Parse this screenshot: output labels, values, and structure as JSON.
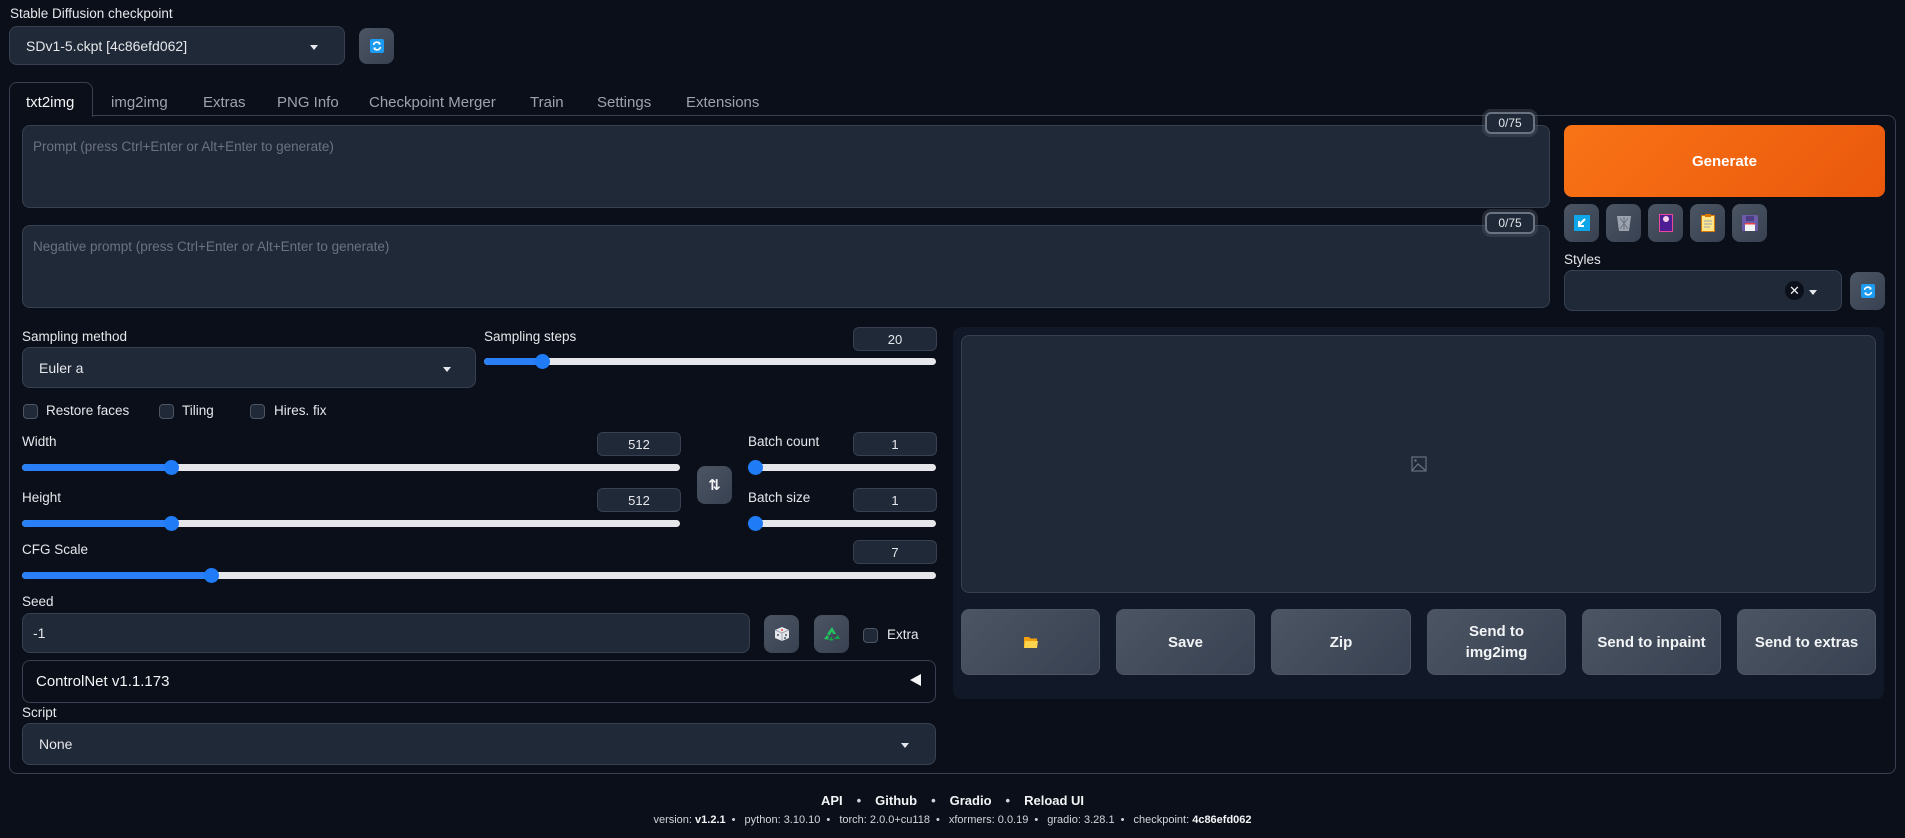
{
  "checkpoint": {
    "label": "Stable Diffusion checkpoint",
    "value": "SDv1-5.ckpt [4c86efd062]",
    "refresh_icon": "refresh-icon"
  },
  "tabs": [
    {
      "label": "txt2img",
      "active": true
    },
    {
      "label": "img2img"
    },
    {
      "label": "Extras"
    },
    {
      "label": "PNG Info"
    },
    {
      "label": "Checkpoint Merger"
    },
    {
      "label": "Train"
    },
    {
      "label": "Settings"
    },
    {
      "label": "Extensions"
    }
  ],
  "prompt": {
    "placeholder": "Prompt (press Ctrl+Enter or Alt+Enter to generate)",
    "value": "",
    "token_count": "0/75"
  },
  "negative_prompt": {
    "placeholder": "Negative prompt (press Ctrl+Enter or Alt+Enter to generate)",
    "value": "",
    "token_count": "0/75"
  },
  "generate": {
    "label": "Generate",
    "color": "#f97316"
  },
  "tool_buttons": [
    {
      "name": "read-params-icon"
    },
    {
      "name": "trash-icon"
    },
    {
      "name": "extra-networks-icon"
    },
    {
      "name": "clipboard-icon"
    },
    {
      "name": "save-style-icon"
    }
  ],
  "styles": {
    "label": "Styles",
    "value": ""
  },
  "sampling_method": {
    "label": "Sampling method",
    "value": "Euler a"
  },
  "sampling_steps": {
    "label": "Sampling steps",
    "value": "20",
    "fraction": 0.128
  },
  "checkboxes": [
    {
      "label": "Restore faces",
      "checked": false
    },
    {
      "label": "Tiling",
      "checked": false
    },
    {
      "label": "Hires. fix",
      "checked": false
    }
  ],
  "width": {
    "label": "Width",
    "value": "512",
    "fraction": 0.226
  },
  "height": {
    "label": "Height",
    "value": "512",
    "fraction": 0.226
  },
  "batch_count": {
    "label": "Batch count",
    "value": "1",
    "fraction": 0
  },
  "batch_size": {
    "label": "Batch size",
    "value": "1",
    "fraction": 0
  },
  "cfg_scale": {
    "label": "CFG Scale",
    "value": "7",
    "fraction": 0.207
  },
  "seed": {
    "label": "Seed",
    "value": "-1",
    "extra_label": "Extra"
  },
  "controlnet": {
    "label": "ControlNet v1.1.173"
  },
  "script": {
    "label": "Script",
    "value": "None"
  },
  "output_actions": [
    {
      "label": "",
      "icon": "folder-icon"
    },
    {
      "label": "Save"
    },
    {
      "label": "Zip"
    },
    {
      "label": "Send to img2img"
    },
    {
      "label": "Send to inpaint"
    },
    {
      "label": "Send to extras"
    }
  ],
  "footer": {
    "links": [
      "API",
      "Github",
      "Gradio",
      "Reload UI"
    ],
    "versions": [
      {
        "k": "version: ",
        "v": "v1.2.1",
        "bold": true
      },
      {
        "k": "python: ",
        "v": "3.10.10"
      },
      {
        "k": "torch: ",
        "v": "2.0.0+cu118"
      },
      {
        "k": "xformers: ",
        "v": "0.0.19"
      },
      {
        "k": "gradio: ",
        "v": "3.28.1"
      },
      {
        "k": "checkpoint: ",
        "v": "4c86efd062",
        "bold": true
      }
    ]
  }
}
